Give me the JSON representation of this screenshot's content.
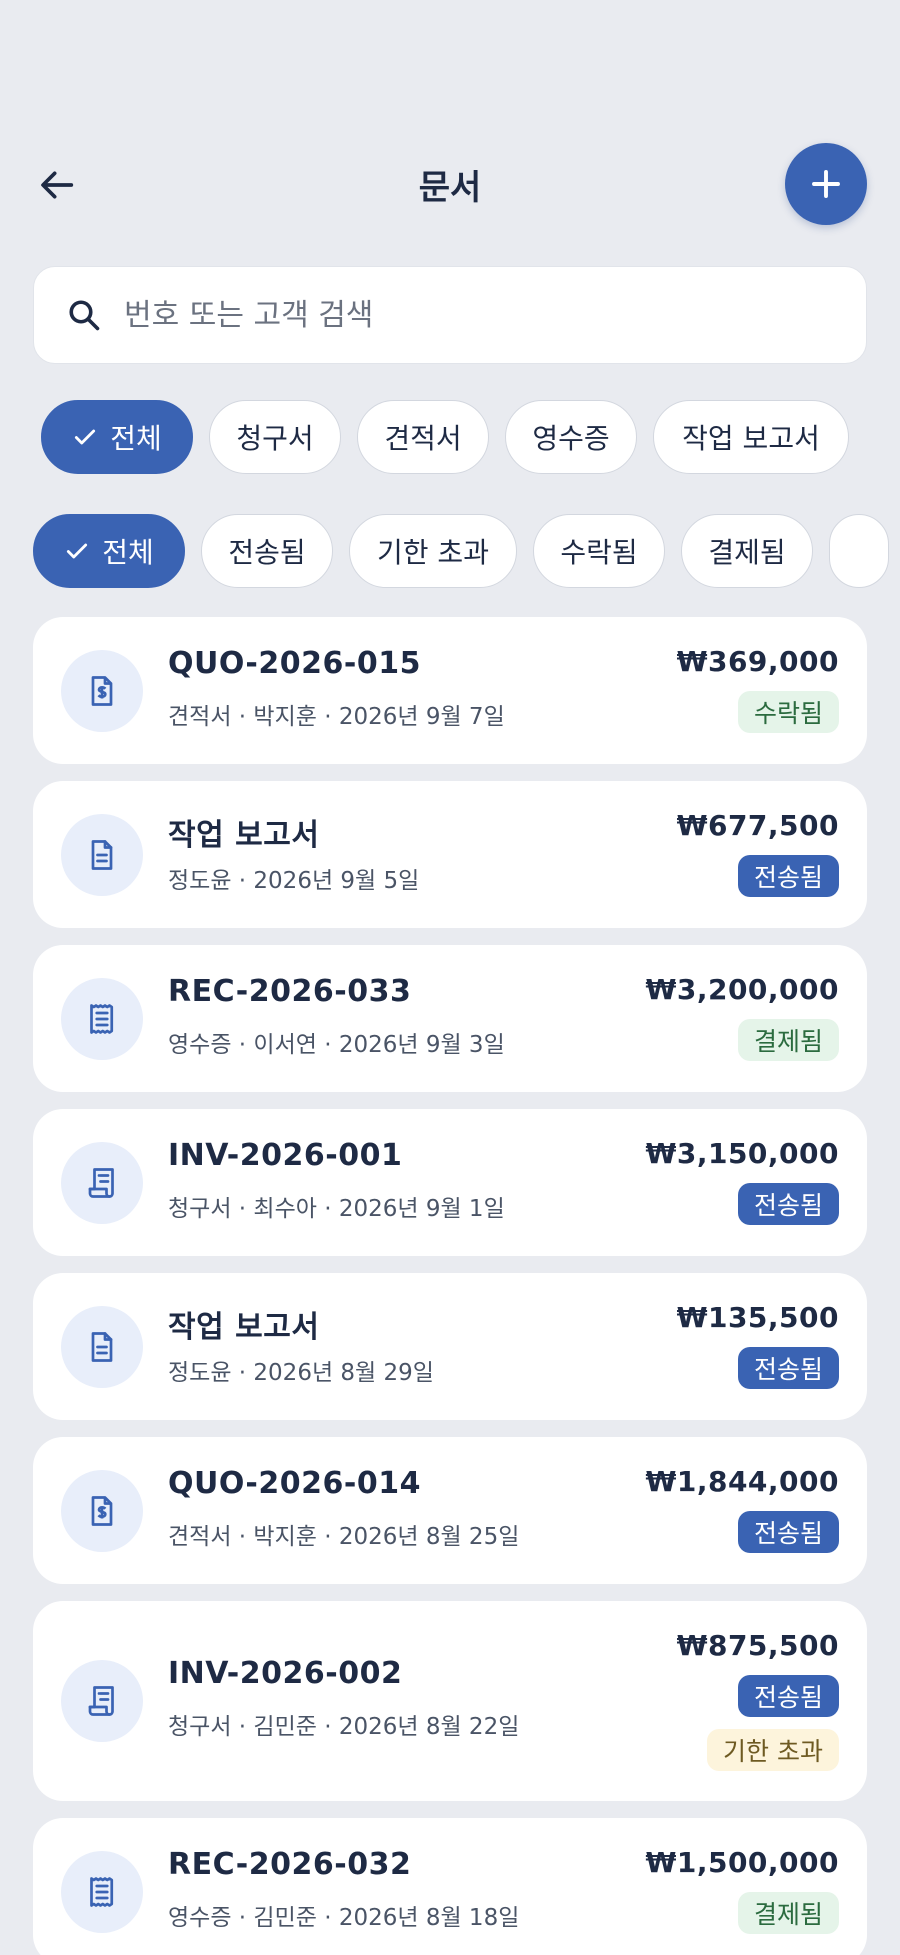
{
  "header": {
    "title": "문서"
  },
  "search": {
    "placeholder": "번호 또는 고객 검색"
  },
  "type_filters": [
    {
      "label": "전체",
      "active": true
    },
    {
      "label": "청구서",
      "active": false
    },
    {
      "label": "견적서",
      "active": false
    },
    {
      "label": "영수증",
      "active": false
    },
    {
      "label": "작업 보고서",
      "active": false
    }
  ],
  "status_filters": [
    {
      "label": "전체",
      "active": true
    },
    {
      "label": "전송됨",
      "active": false
    },
    {
      "label": "기한 초과",
      "active": false
    },
    {
      "label": "수락됨",
      "active": false
    },
    {
      "label": "결제됨",
      "active": false
    },
    {
      "label": "",
      "active": false
    }
  ],
  "documents": [
    {
      "icon": "quote-icon",
      "title": "QUO-2026-015",
      "subtitle": "견적서 · 박지훈 · 2026년 9월 7일",
      "amount": "₩369,000",
      "badges": [
        {
          "label": "수락됨",
          "kind": "accepted"
        }
      ]
    },
    {
      "icon": "report-icon",
      "title": "작업 보고서",
      "subtitle": "정도윤 · 2026년 9월 5일",
      "amount": "₩677,500",
      "badges": [
        {
          "label": "전송됨",
          "kind": "sent"
        }
      ]
    },
    {
      "icon": "receipt-icon",
      "title": "REC-2026-033",
      "subtitle": "영수증 · 이서연 · 2026년 9월 3일",
      "amount": "₩3,200,000",
      "badges": [
        {
          "label": "결제됨",
          "kind": "paid"
        }
      ]
    },
    {
      "icon": "invoice-icon",
      "title": "INV-2026-001",
      "subtitle": "청구서 · 최수아 · 2026년 9월 1일",
      "amount": "₩3,150,000",
      "badges": [
        {
          "label": "전송됨",
          "kind": "sent"
        }
      ]
    },
    {
      "icon": "report-icon",
      "title": "작업 보고서",
      "subtitle": "정도윤 · 2026년 8월 29일",
      "amount": "₩135,500",
      "badges": [
        {
          "label": "전송됨",
          "kind": "sent"
        }
      ]
    },
    {
      "icon": "quote-icon",
      "title": "QUO-2026-014",
      "subtitle": "견적서 · 박지훈 · 2026년 8월 25일",
      "amount": "₩1,844,000",
      "badges": [
        {
          "label": "전송됨",
          "kind": "sent"
        }
      ]
    },
    {
      "icon": "invoice-icon",
      "title": "INV-2026-002",
      "subtitle": "청구서 · 김민준 · 2026년 8월 22일",
      "amount": "₩875,500",
      "badges": [
        {
          "label": "전송됨",
          "kind": "sent"
        },
        {
          "label": "기한 초과",
          "kind": "overdue"
        }
      ]
    },
    {
      "icon": "receipt-icon",
      "title": "REC-2026-032",
      "subtitle": "영수증 · 김민준 · 2026년 8월 18일",
      "amount": "₩1,500,000",
      "badges": [
        {
          "label": "결제됨",
          "kind": "paid"
        }
      ]
    }
  ],
  "colors": {
    "accent": "#3a63b3",
    "background": "#e9ebf0"
  }
}
